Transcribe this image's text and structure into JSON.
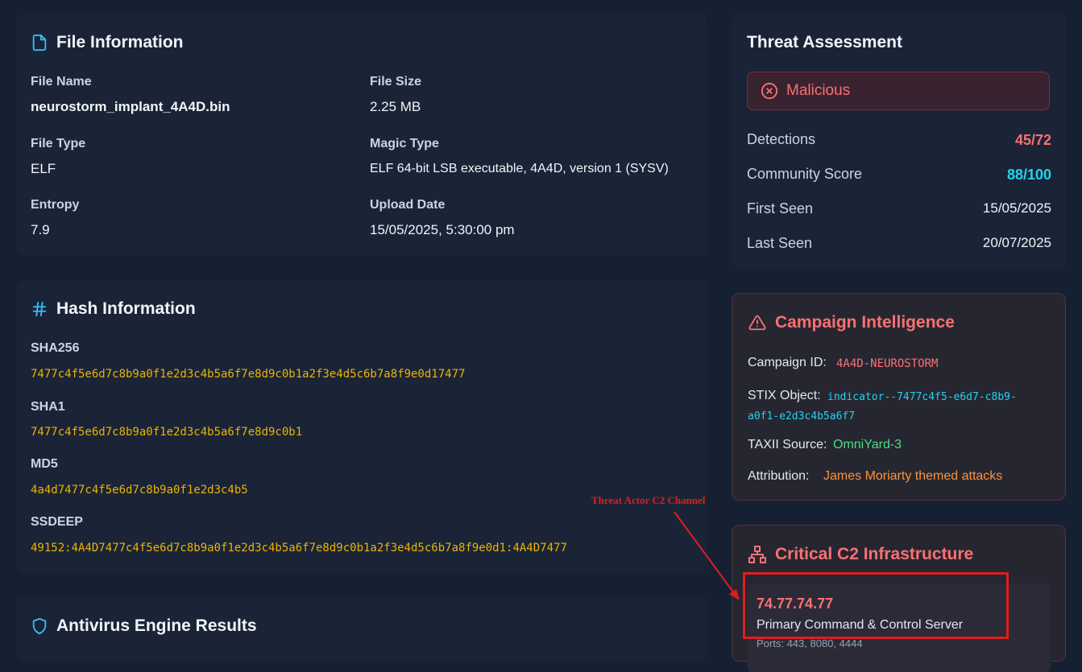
{
  "file_info": {
    "title": "File Information",
    "icon": "file-icon",
    "fields": [
      {
        "label": "File Name",
        "value": "neurostorm_implant_4A4D.bin"
      },
      {
        "label": "File Size",
        "value": "2.25 MB"
      },
      {
        "label": "File Type",
        "value": "ELF"
      },
      {
        "label": "Magic Type",
        "value": "ELF 64-bit LSB executable, 4A4D, version 1 (SYSV)"
      },
      {
        "label": "Entropy",
        "value": "7.9"
      },
      {
        "label": "Upload Date",
        "value": "15/05/2025, 5:30:00 pm"
      }
    ]
  },
  "hash_info": {
    "title": "Hash Information",
    "icon": "hash-icon",
    "hashes": [
      {
        "label": "SHA256",
        "value": "7477c4f5e6d7c8b9a0f1e2d3c4b5a6f7e8d9c0b1a2f3e4d5c6b7a8f9e0d17477"
      },
      {
        "label": "SHA1",
        "value": "7477c4f5e6d7c8b9a0f1e2d3c4b5a6f7e8d9c0b1"
      },
      {
        "label": "MD5",
        "value": "4a4d7477c4f5e6d7c8b9a0f1e2d3c4b5"
      },
      {
        "label": "SSDEEP",
        "value": "49152:4A4D7477c4f5e6d7c8b9a0f1e2d3c4b5a6f7e8d9c0b1a2f3e4d5c6b7a8f9e0d1:4A4D7477"
      }
    ]
  },
  "antivirus": {
    "title": "Antivirus Engine Results",
    "icon": "shield-icon"
  },
  "threat_assessment": {
    "title": "Threat Assessment",
    "verdict": "Malicious",
    "verdict_icon": "x-circle-icon",
    "rows": [
      {
        "label": "Detections",
        "value": "45/72"
      },
      {
        "label": "Community Score",
        "value": "88/100"
      },
      {
        "label": "First Seen",
        "value": "15/05/2025"
      },
      {
        "label": "Last Seen",
        "value": "20/07/2025"
      }
    ],
    "colors": {
      "malicious": "#f87171",
      "score": "#22d3ee"
    }
  },
  "campaign": {
    "title": "Campaign Intelligence",
    "icon": "warning-triangle-icon",
    "campaign_id_label": "Campaign ID:",
    "campaign_id": "4A4D-NEUROSTORM",
    "stix_label": "STIX Object:",
    "stix_line1": "indicator--7477c4f5-e6d7-c8b9-",
    "stix_line2": "a0f1-e2d3c4b5a6f7",
    "taxii_label": "TAXII Source:",
    "taxii": "OmniYard-3",
    "attribution_label": "Attribution:",
    "attribution": "James Moriarty themed attacks"
  },
  "c2": {
    "title": "Critical C2 Infrastructure",
    "icon": "network-icon",
    "ip": "74.77.74.77",
    "description": "Primary Command & Control Server",
    "ports": "Ports: 443, 8080, 4444"
  },
  "annotation": {
    "text": "Threat Actor C2 Channel",
    "color": "#e11d1d"
  }
}
